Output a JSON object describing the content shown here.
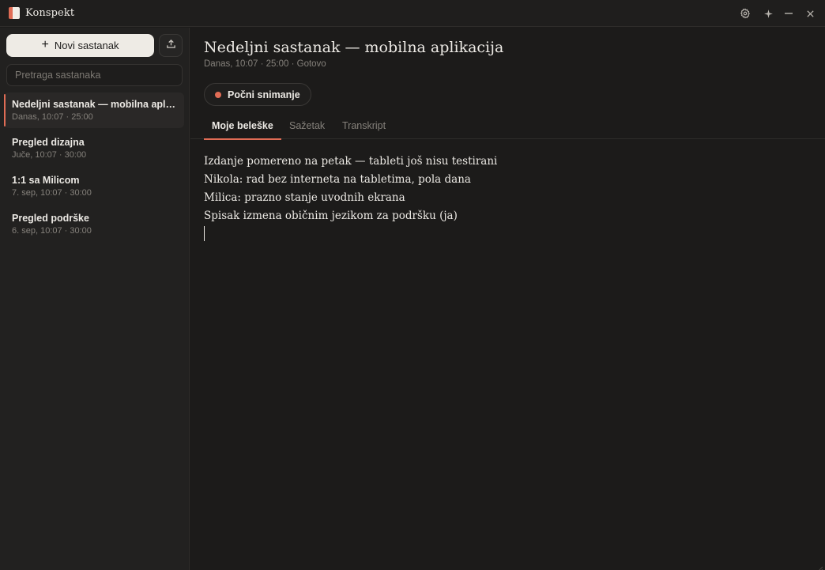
{
  "app": {
    "title": "Konspekt",
    "colors": {
      "accent": "#e06c55",
      "background": "#1c1b1a",
      "sidebar": "#222120"
    }
  },
  "titlebar": {
    "icons": [
      "gear-icon",
      "sparkle-icon",
      "minimize-icon",
      "close-icon"
    ]
  },
  "sidebar": {
    "new_meeting_label": "Novi sastanak",
    "export_icon": "upload-icon",
    "search": {
      "placeholder": "Pretraga sastanaka",
      "value": ""
    },
    "meetings": [
      {
        "title": "Nedeljni sastanak — mobilna aplikacija",
        "meta": "Danas, 10:07 · 25:00",
        "active": true
      },
      {
        "title": "Pregled dizajna",
        "meta": "Juče, 10:07 · 30:00",
        "active": false
      },
      {
        "title": "1:1 sa Milicom",
        "meta": "7. sep, 10:07 · 30:00",
        "active": false
      },
      {
        "title": "Pregled podrške",
        "meta": "6. sep, 10:07 · 30:00",
        "active": false
      }
    ]
  },
  "main": {
    "title": "Nedeljni sastanak — mobilna aplikacija",
    "meta": "Danas, 10:07 · 25:00 · Gotovo",
    "record_label": "Počni snimanje",
    "tabs": [
      {
        "label": "Moje beleške",
        "active": true
      },
      {
        "label": "Sažetak",
        "active": false
      },
      {
        "label": "Transkript",
        "active": false
      }
    ],
    "notes": [
      "Izdanje pomereno na petak — tableti još nisu testirani",
      "Nikola: rad bez interneta na tabletima, pola dana",
      "Milica: prazno stanje uvodnih ekrana",
      "Spisak izmena običnim jezikom za podršku (ja)"
    ]
  }
}
